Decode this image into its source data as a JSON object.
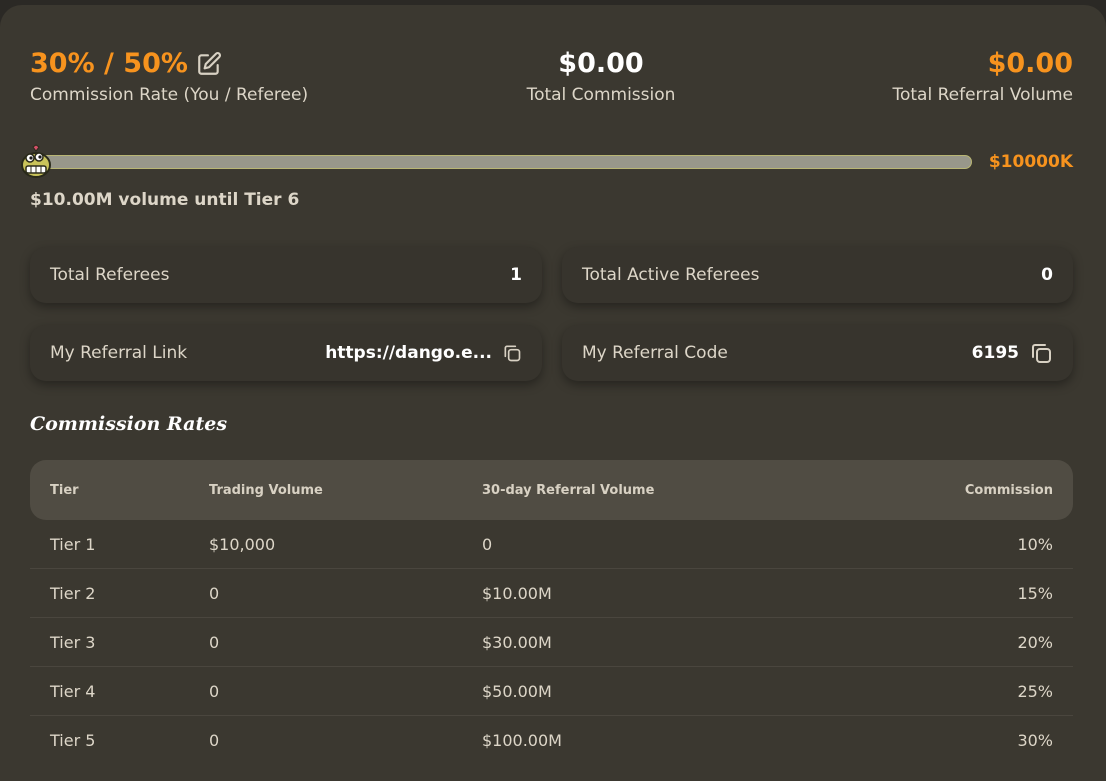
{
  "stats": {
    "commission_rate": {
      "value": "30% / 50%",
      "label": "Commission Rate (You / Referee)",
      "icon": "edit-icon"
    },
    "total_commission": {
      "value": "$0.00",
      "label": "Total Commission"
    },
    "total_referral_volume": {
      "value": "$0.00",
      "label": "Total Referral Volume"
    }
  },
  "progress": {
    "fraction": 0.0,
    "max_label": "$10000K",
    "note": "$10.00M volume until Tier 6"
  },
  "cards": {
    "total_referees": {
      "label": "Total Referees",
      "value": "1"
    },
    "total_active_referees": {
      "label": "Total Active Referees",
      "value": "0"
    },
    "referral_link": {
      "label": "My Referral Link",
      "value": "https://dango.e...",
      "icon": "copy-icon"
    },
    "referral_code": {
      "label": "My Referral Code",
      "value": "6195",
      "icon": "copy-icon"
    }
  },
  "commission_rates": {
    "title": "Commission Rates",
    "headers": [
      "Tier",
      "Trading Volume",
      "30-day Referral Volume",
      "Commission"
    ],
    "rows": [
      [
        "Tier 1",
        "$10,000",
        "0",
        "10%"
      ],
      [
        "Tier 2",
        "0",
        "$10.00M",
        "15%"
      ],
      [
        "Tier 3",
        "0",
        "$30.00M",
        "20%"
      ],
      [
        "Tier 4",
        "0",
        "$50.00M",
        "25%"
      ],
      [
        "Tier 5",
        "0",
        "$100.00M",
        "30%"
      ]
    ]
  },
  "colors": {
    "accent": "#f7931e",
    "panel": "#3b3830",
    "card": "#37342d",
    "progress_track": "#98978a"
  }
}
